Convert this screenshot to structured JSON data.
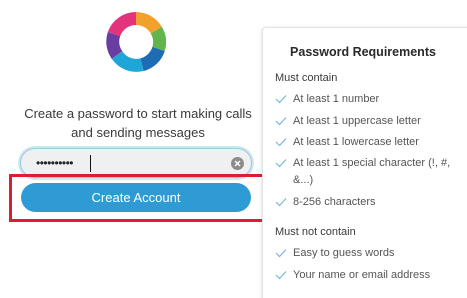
{
  "app": {
    "logo_icon": "webex-teams-logo-icon",
    "prompt_text": "Create a password to start making calls\nand sending messages"
  },
  "password_field": {
    "value": "••••••••••",
    "clear_icon": "clear-x-icon"
  },
  "create_button": {
    "label": "Create Account",
    "color": "#2f9bd4",
    "highlight_color": "#dd1e2f"
  },
  "requirements": {
    "title": "Password Requirements",
    "must_contain_label": "Must contain",
    "must_contain": [
      "At least 1 number",
      "At least 1 uppercase letter",
      "At least 1 lowercase letter",
      "At least 1 special character (!, #, &...)",
      "8-256 characters"
    ],
    "must_not_contain_label": "Must not contain",
    "must_not_contain": [
      "Easy to guess words",
      "Your name or email address"
    ],
    "check_icon": "checkmark-icon",
    "check_color": "#7fb7d6"
  }
}
